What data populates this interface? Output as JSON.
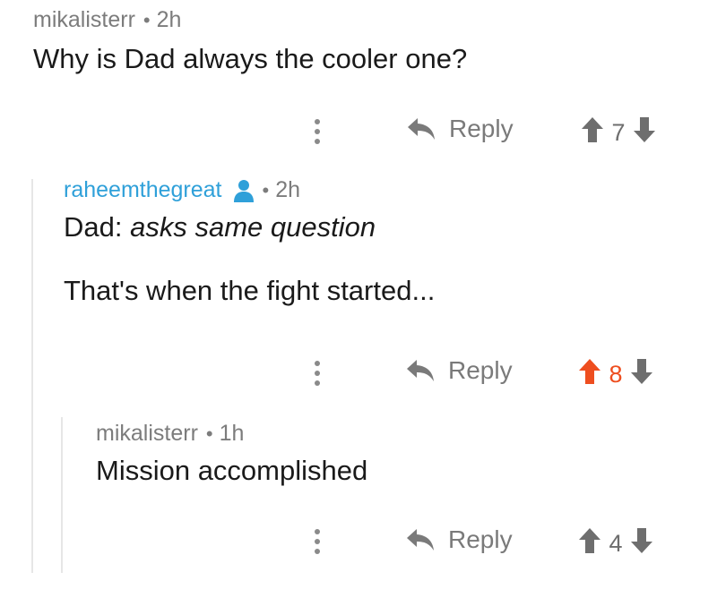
{
  "comments": [
    {
      "author": "mikalisterr",
      "age": "2h",
      "body_lines": [
        "Why is Dad always the cooler one?"
      ],
      "reply_label": "Reply",
      "score": "7"
    },
    {
      "author": "raheemthegreat",
      "age": "2h",
      "body_prefix": "Dad: ",
      "body_italic": "asks same question",
      "body_line2": "That's when the fight started...",
      "reply_label": "Reply",
      "score": "8"
    },
    {
      "author": "mikalisterr",
      "age": "1h",
      "body_lines": [
        "Mission accomplished"
      ],
      "reply_label": "Reply",
      "score": "4"
    }
  ],
  "colors": {
    "meta_gray": "#7c7c7c",
    "author_blue": "#2fa0d9",
    "upvote_orange": "#ee4e1f",
    "thread_line": "#e6e6e6"
  },
  "icons": {
    "more": "kebab-icon",
    "reply": "reply-arrow-icon",
    "upvote": "upvote-arrow-icon",
    "downvote": "downvote-arrow-icon",
    "user": "user-icon"
  },
  "separator": "•"
}
